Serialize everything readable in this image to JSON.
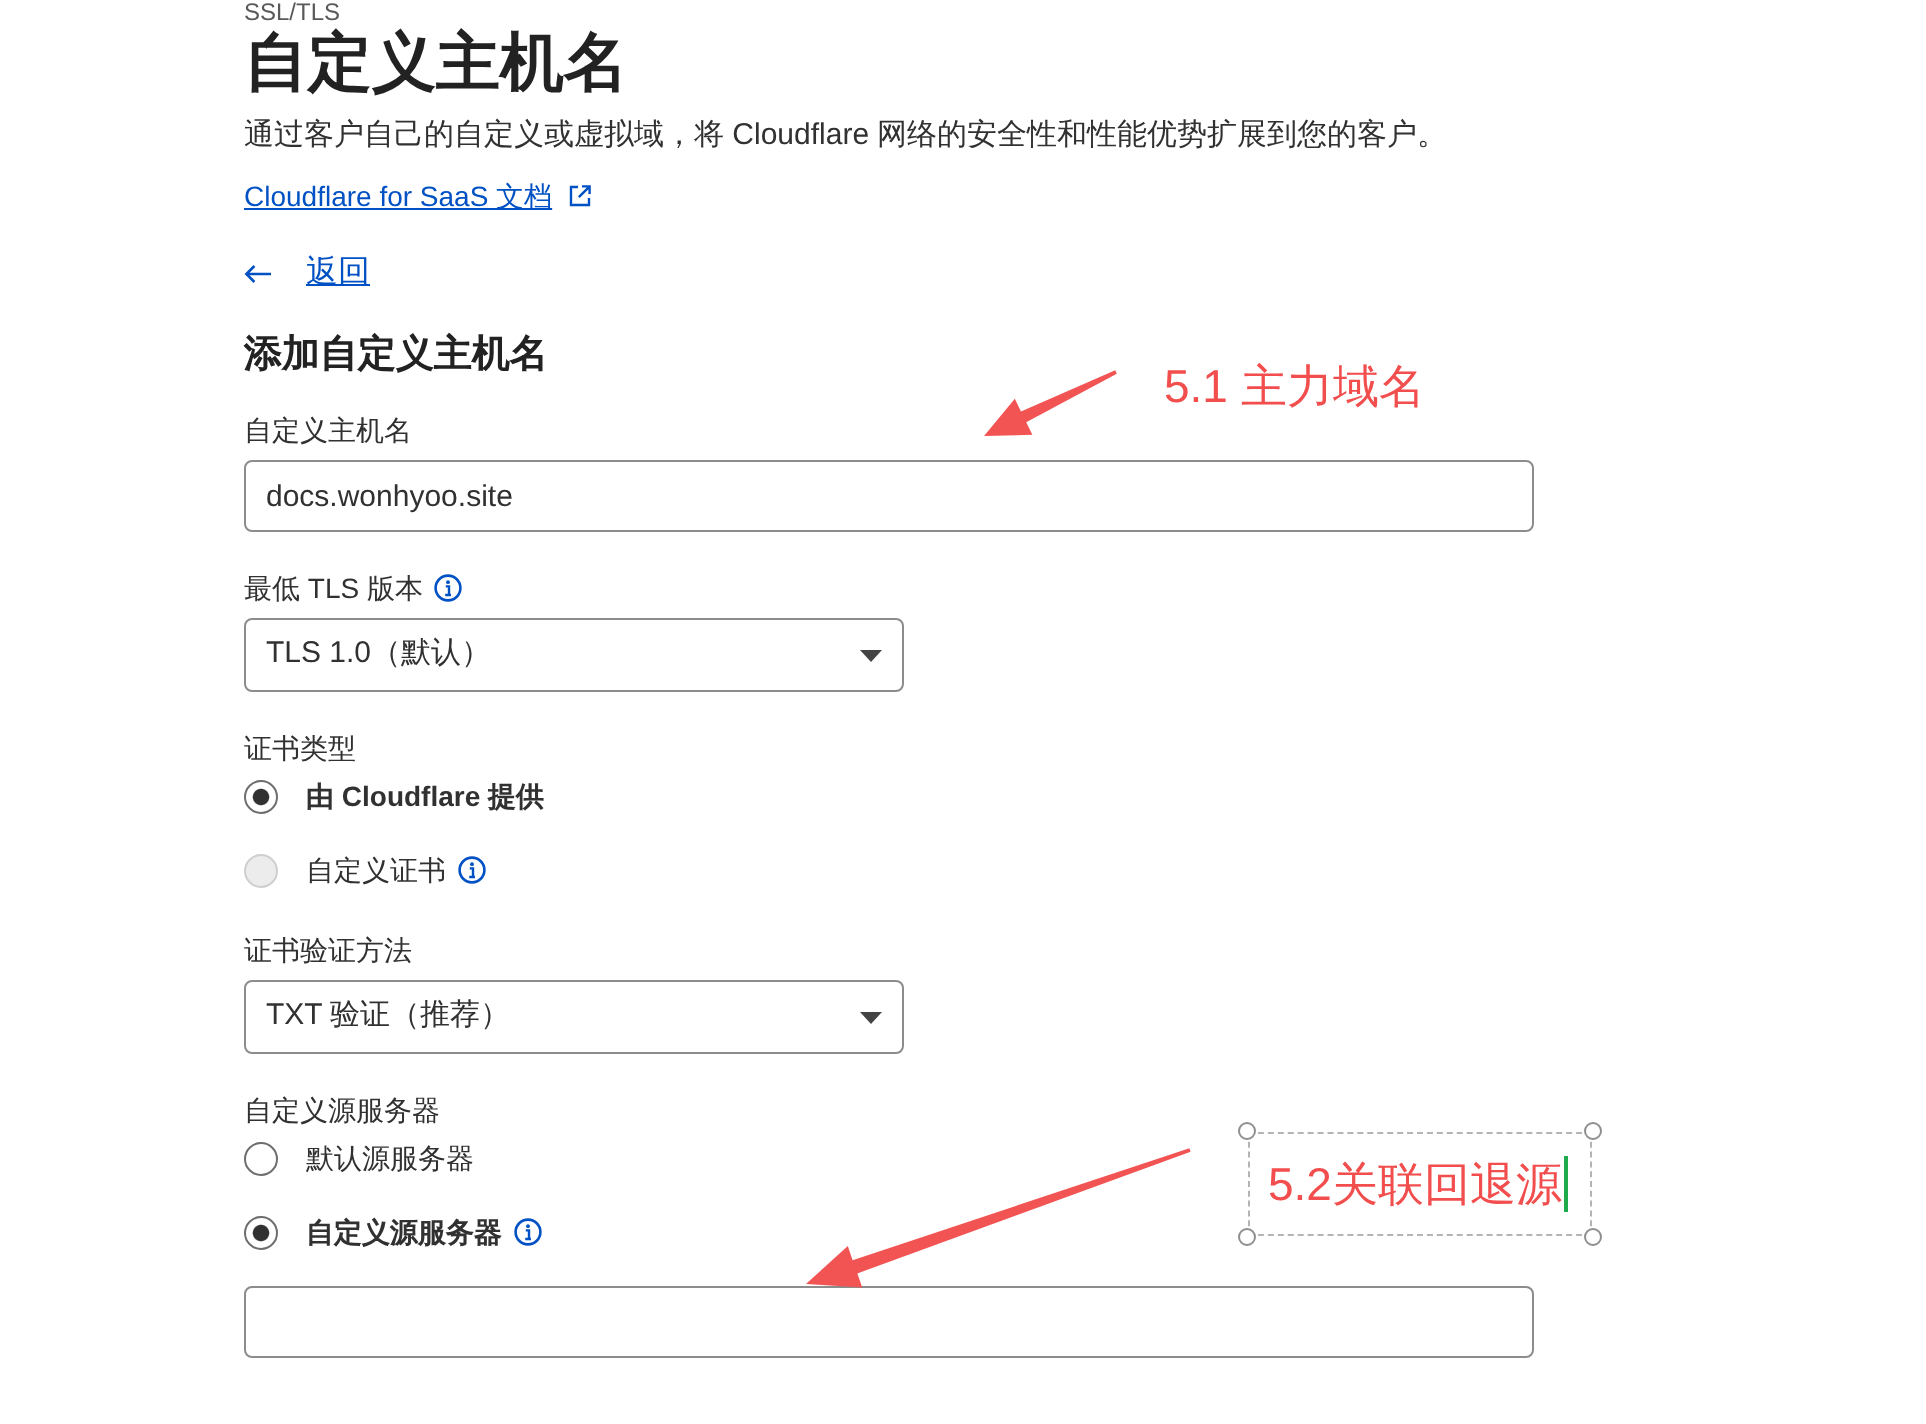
{
  "breadcrumb": "SSL/TLS",
  "title": "自定义主机名",
  "description": "通过客户自己的自定义或虚拟域，将 Cloudflare 网络的安全性和性能优势扩展到您的客户。",
  "docs_link": "Cloudflare for SaaS 文档",
  "back_link": "返回",
  "form": {
    "heading": "添加自定义主机名",
    "fields": [
      {
        "kind": "text",
        "label": "自定义主机名",
        "info": false,
        "value": "docs.wonhyoo.site"
      },
      {
        "kind": "select",
        "label": "最低 TLS 版本",
        "info": true,
        "value": "TLS 1.0（默认）"
      },
      {
        "kind": "radio",
        "label": "证书类型",
        "info": false,
        "options": [
          {
            "label": "由 Cloudflare 提供",
            "selected": true,
            "disabled": false,
            "info": false
          },
          {
            "label": "自定义证书",
            "selected": false,
            "disabled": true,
            "info": true
          }
        ]
      },
      {
        "kind": "select",
        "label": "证书验证方法",
        "info": false,
        "value": "TXT 验证（推荐）"
      },
      {
        "kind": "radio",
        "label": "自定义源服务器",
        "info": false,
        "options": [
          {
            "label": "默认源服务器",
            "selected": false,
            "disabled": false,
            "info": false
          },
          {
            "label": "自定义源服务器",
            "selected": true,
            "disabled": false,
            "info": true
          }
        ]
      },
      {
        "kind": "text"
      }
    ]
  },
  "annotations": [
    {
      "text": "5.1 主力域名",
      "selected": false
    },
    {
      "text": "5.2关联回退源",
      "selected": true
    }
  ]
}
